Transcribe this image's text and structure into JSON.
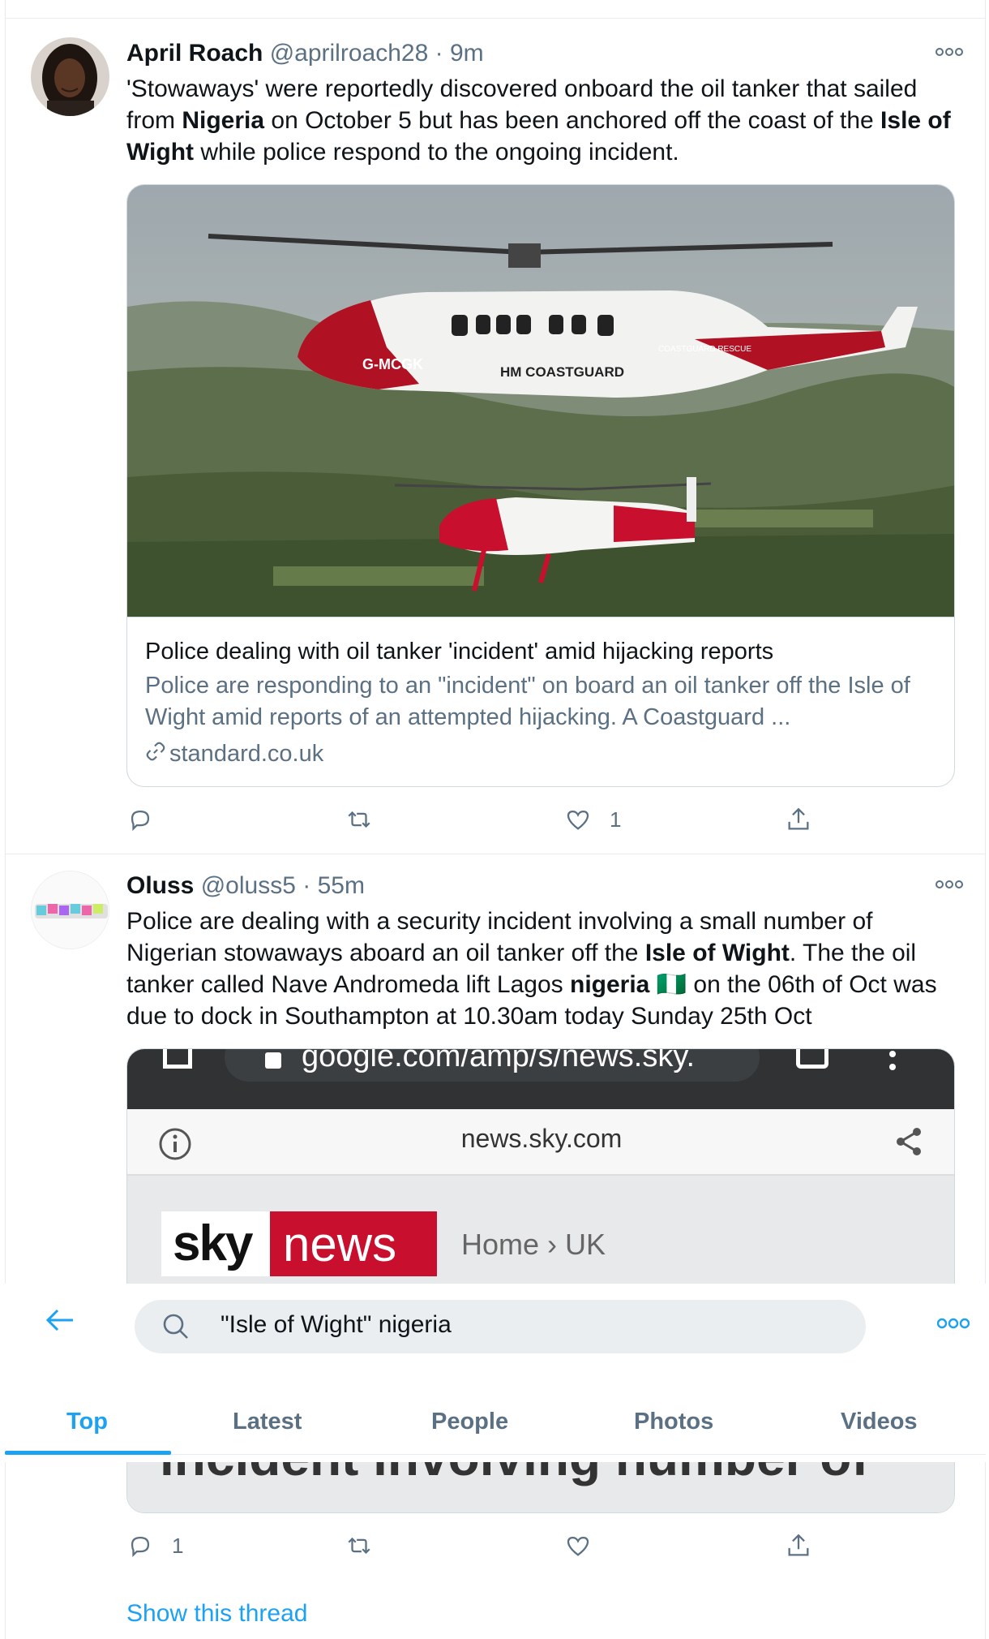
{
  "tweets": [
    {
      "name": "April Roach",
      "handle": "@aprilroach28",
      "dot": "·",
      "time": "9m",
      "text_parts": [
        {
          "t": "'Stowaways' were reportedly discovered onboard the oil tanker that sailed from ",
          "b": false
        },
        {
          "t": "Nigeria",
          "b": true
        },
        {
          "t": " on October 5 but has been anchored off the coast of the ",
          "b": false
        },
        {
          "t": "Isle of Wight",
          "b": true
        },
        {
          "t": " while police respond to the ongoing incident.",
          "b": false
        }
      ],
      "card": {
        "image_label": "G-MCGK",
        "image_label2": "HM COASTGUARD",
        "image_label3": "COASTGUARD RESCUE",
        "title": "Police dealing with oil tanker 'incident' amid hijacking reports",
        "description": "Police are responding to an \"incident\" on board an oil tanker off the Isle of Wight amid reports of an attempted hijacking. A Coastguard ...",
        "domain": "standard.co.uk"
      },
      "actions": {
        "reply": "",
        "retweet": "",
        "like": "1",
        "share": ""
      }
    },
    {
      "name": "Oluss",
      "handle": "@oluss5",
      "dot": "·",
      "time": "55m",
      "text_parts": [
        {
          "t": "Police are dealing with a security incident involving a small number of Nigerian stowaways aboard an oil tanker off the ",
          "b": false
        },
        {
          "t": "Isle of Wight",
          "b": true
        },
        {
          "t": ". The the oil tanker called Nave Andromeda lift Lagos ",
          "b": false
        },
        {
          "t": "nigeria",
          "b": true
        },
        {
          "t": " 🇳🇬 on the 06th of Oct was due to dock in Southampton at 10.30am today Sunday 25th Oct",
          "b": false
        }
      ],
      "embedded": {
        "browser_url": "google.com/amp/s/news.sky.",
        "site": "news.sky.com",
        "logo_sky": "sky",
        "logo_news": "news",
        "breadcrumb": "Home › UK",
        "headline_fragment": "incident involving number of"
      },
      "actions": {
        "reply": "1",
        "retweet": "",
        "like": "",
        "share": ""
      },
      "show_thread": "Show this thread"
    }
  ],
  "search": {
    "query": "\"Isle of Wight\" nigeria"
  },
  "tabs": [
    "Top",
    "Latest",
    "People",
    "Photos",
    "Videos"
  ],
  "active_tab": "Top",
  "colors": {
    "accent": "#1da1f2",
    "secondary": "#5b7083",
    "border": "#e6ecf0",
    "sky_red": "#c8102e"
  }
}
